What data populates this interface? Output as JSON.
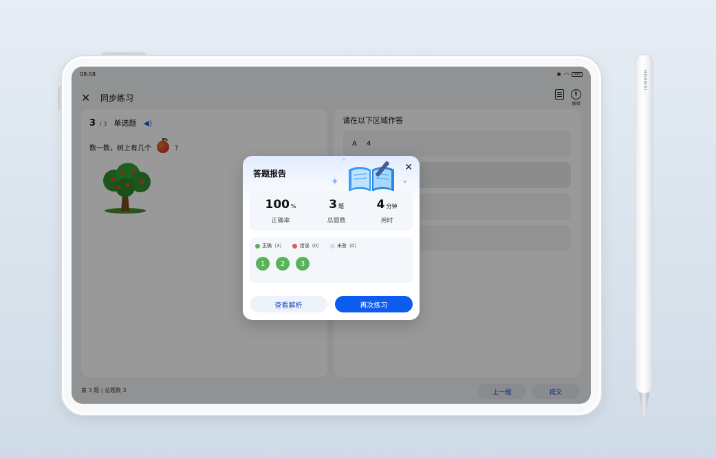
{
  "status_bar": {
    "time": "08:08",
    "battery": "100"
  },
  "header": {
    "title": "同步练习",
    "report_label": "报错"
  },
  "question": {
    "number": "3",
    "total": "/ 3",
    "type": "单选题",
    "text": "数一数，树上有几个",
    "suffix": "？"
  },
  "answer_area": {
    "heading": "请在以下区域作答",
    "options": [
      {
        "letter": "A",
        "value": "4"
      },
      {
        "letter": "",
        "value": ""
      },
      {
        "letter": "",
        "value": ""
      },
      {
        "letter": "",
        "value": ""
      }
    ]
  },
  "footer": {
    "progress": "第 3 题 | 总题数 3",
    "prev_label": "上一题",
    "submit_label": "提交"
  },
  "report": {
    "title": "答题报告",
    "stats": [
      {
        "value": "100",
        "unit": "%",
        "label": "正确率"
      },
      {
        "value": "3",
        "unit": "题",
        "label": "总题数"
      },
      {
        "value": "4",
        "unit": "分钟",
        "label": "用时"
      }
    ],
    "legend": [
      {
        "label": "正确（3）",
        "color": "#5ab25a"
      },
      {
        "label": "错误（0）",
        "color": "#e8574f"
      },
      {
        "label": "未答（0）",
        "color": "#d9dde3"
      }
    ],
    "answers": [
      "1",
      "2",
      "3"
    ],
    "analysis_label": "查看解析",
    "retry_label": "再次练习"
  },
  "pen": {
    "brand": "HUAWEI"
  },
  "colors": {
    "accent": "#0c5cf0",
    "correct": "#5ab25a",
    "wrong": "#e8574f"
  }
}
